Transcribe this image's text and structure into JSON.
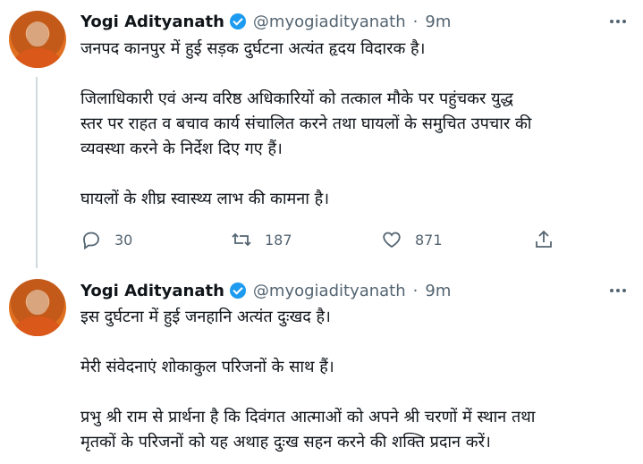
{
  "tweets": [
    {
      "author": "Yogi Adityanath",
      "handle": "@myogiadityanath",
      "separator": "·",
      "time": "9m",
      "lines": [
        "जनपद कानपुर में हुई सड़क दुर्घटना अत्यंत हृदय विदारक है।",
        "जिलाधिकारी एवं अन्य वरिष्ठ अधिकारियों को तत्काल मौके पर पहुंचकर युद्ध",
        "स्तर पर राहत व बचाव कार्य संचालित करने तथा घायलों के समुचित उपचार की",
        "व्यवस्था करने के निर्देश दिए गए हैं।",
        "घायलों के शीघ्र स्वास्थ्य लाभ की कामना है।"
      ],
      "stats": {
        "replies": "30",
        "retweets": "187",
        "likes": "871"
      }
    },
    {
      "author": "Yogi Adityanath",
      "handle": "@myogiadityanath",
      "separator": "·",
      "time": "9m",
      "lines": [
        "इस दुर्घटना में हुई जनहानि अत्यंत दुःखद है।",
        "मेरी संवेदनाएं शोकाकुल परिजनों के साथ हैं।",
        "प्रभु श्री राम से प्रार्थना है कि दिवंगत आत्माओं को अपने श्री चरणों में स्थान तथा",
        "मृतकों के परिजनों को यह अथाह दुःख सहन करने की शक्ति प्रदान करें।"
      ]
    }
  ],
  "icons": {
    "reply": "reply-icon",
    "retweet": "retweet-icon",
    "like": "like-icon",
    "share": "share-icon",
    "more": "more-icon",
    "verified": "verified-badge-icon"
  },
  "colors": {
    "verified": "#1d9bf0",
    "secondary_text": "#536471",
    "thread_line": "#cfd9de"
  }
}
